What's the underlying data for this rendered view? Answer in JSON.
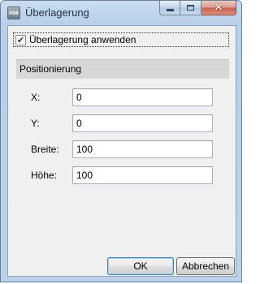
{
  "window": {
    "title": "Überlagerung",
    "app_icon_text": "PDB"
  },
  "options": {
    "apply_overlay": {
      "label": "Überlagerung anwenden",
      "checked": true
    }
  },
  "positioning": {
    "header": "Positionierung",
    "fields": [
      {
        "label": "X:",
        "value": "0"
      },
      {
        "label": "Y:",
        "value": "0"
      },
      {
        "label": "Breite:",
        "value": "100"
      },
      {
        "label": "Höhe:",
        "value": "100"
      }
    ]
  },
  "buttons": {
    "ok_label": "OK",
    "cancel_label": "Abbrechen"
  },
  "colors": {
    "frame_accent": "#b9d0ea",
    "client_background": "#f0f0f0",
    "group_header_background": "#d7d7d7",
    "close_button": "#c8604e",
    "default_button_border": "#3c7fb1"
  }
}
